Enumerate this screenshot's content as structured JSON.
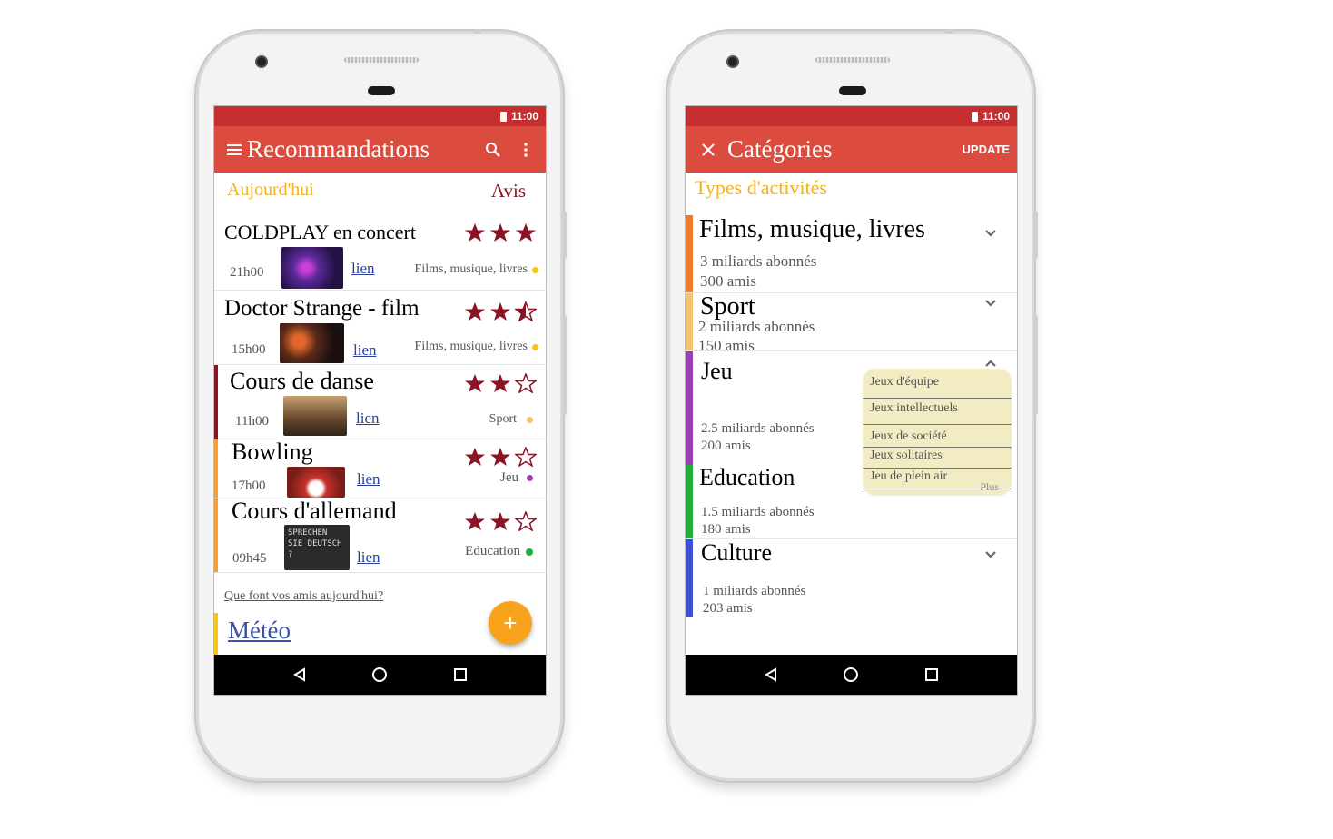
{
  "left_phone": {
    "status_time": "11:00",
    "app_title": "Recommandations",
    "icons": [
      "menu-icon",
      "search-icon",
      "more-vert-icon"
    ],
    "tabs": {
      "today": "Aujourd'hui",
      "reviews": "Avis"
    },
    "recommendations": [
      {
        "name": "COLDPLAY en concert",
        "time": "21h00",
        "link": "lien",
        "category": "Films, musique, livres",
        "rating": 3,
        "dot_color": "#f5c518"
      },
      {
        "name": "Doctor Strange - film",
        "time": "15h00",
        "link": "lien",
        "category": "Films, musique, livres",
        "rating": 2.5,
        "dot_color": "#f5c518"
      },
      {
        "name": "Cours de danse",
        "time": "11h00",
        "link": "lien",
        "category": "Sport",
        "rating": 2,
        "dot_color": "#f5c36a"
      },
      {
        "name": "Bowling",
        "time": "17h00",
        "link": "lien",
        "category": "Jeu",
        "rating": 2,
        "dot_color": "#9c3fb5"
      },
      {
        "name": "Cours d'allemand",
        "time": "09h45",
        "link": "lien",
        "category": "Education",
        "rating": 2,
        "dot_color": "#1fae3b"
      }
    ],
    "friends_link": "Que font vos amis aujourd'hui?",
    "meteo": "Météo",
    "fab": "+",
    "thumb_text": "SPRECHEN SIE DEUTSCH ?",
    "colors": {
      "status": "#c62f2f",
      "appbar": "#dc4c3e",
      "star": "#8b1424",
      "accent": "#f9a21b"
    }
  },
  "right_phone": {
    "status_time": "11:00",
    "app_title": "Catégories",
    "action": "UPDATE",
    "heading": "Types d'activités",
    "categories": [
      {
        "name": "Films, musique, livres",
        "subscribers": "3 miliards abonnés",
        "friends": "300 amis",
        "color": "#f07a2a"
      },
      {
        "name": "Sport",
        "subscribers": "2 miliards abonnés",
        "friends": "150 amis",
        "color": "#f5c36a"
      },
      {
        "name": "Jeu",
        "subscribers": "2.5 miliards abonnés",
        "friends": "200 amis",
        "color": "#9c3fb5"
      },
      {
        "name": "Education",
        "subscribers": "1.5 miliards abonnés",
        "friends": "180 amis",
        "color": "#1fae3b"
      },
      {
        "name": "Culture",
        "subscribers": "1 miliards abonnés",
        "friends": "203 amis",
        "color": "#3e4fd2"
      }
    ],
    "jeu_options": [
      "Jeux d'équipe",
      "Jeux intellectuels",
      "Jeux de société",
      "Jeux solitaires",
      "Jeu de plein air"
    ],
    "more": "Plus"
  }
}
